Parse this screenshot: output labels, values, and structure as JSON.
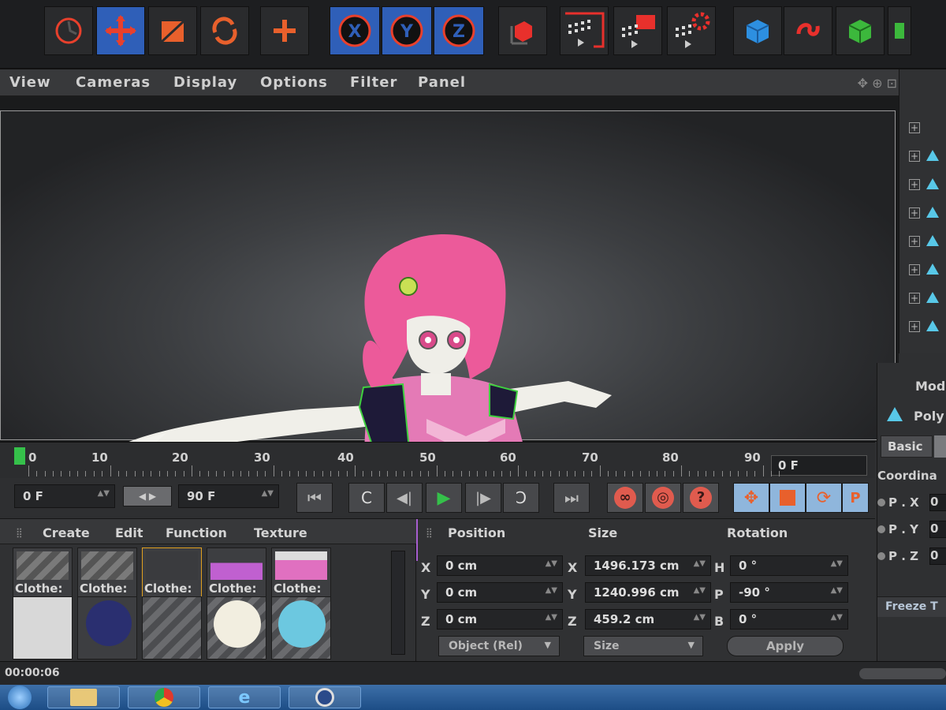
{
  "menubar": {
    "items": [
      "View",
      "Cameras",
      "Display",
      "Options",
      "Filter",
      "Panel"
    ]
  },
  "timeline": {
    "ticks": [
      "0",
      "10",
      "20",
      "30",
      "40",
      "50",
      "60",
      "70",
      "80",
      "90"
    ],
    "current_frame": "0 F"
  },
  "transport": {
    "start_frame": "0 F",
    "end_frame": "90 F"
  },
  "material_manager": {
    "menu": [
      "Create",
      "Edit",
      "Function",
      "Texture"
    ],
    "materials": [
      "Clothe:",
      "Clothe:",
      "Clothe:",
      "Clothe:",
      "Clothe:"
    ]
  },
  "coordinates": {
    "headers": {
      "position": "Position",
      "size": "Size",
      "rotation": "Rotation"
    },
    "axes": {
      "x": "X",
      "y": "Y",
      "z": "Z"
    },
    "rot_axes": {
      "h": "H",
      "p": "P",
      "b": "B"
    },
    "position": {
      "x": "0 cm",
      "y": "0 cm",
      "z": "0 cm"
    },
    "size": {
      "x": "1496.173 cm",
      "y": "1240.996 cm",
      "z": "459.2 cm"
    },
    "rotation": {
      "h": "0 °",
      "p": "-90 °",
      "b": "0 °"
    },
    "mode_dropdown": "Object (Rel)",
    "size_dropdown": "Size",
    "apply_label": "Apply"
  },
  "attributes": {
    "mode_label": "Mod",
    "object_label": "Poly",
    "basic_tab": "Basic",
    "section": "Coordina",
    "rows": [
      "P . X",
      "P . Y",
      "P . Z"
    ],
    "row_values": [
      "0",
      "0",
      "0"
    ],
    "freeze": "Freeze T"
  },
  "status": {
    "time": "00:00:06"
  },
  "colors": {
    "accent_blue": "#2f5fb8",
    "tool_red": "#e8402c",
    "play_green": "#35c04a"
  },
  "icons": {
    "toolbar": [
      "live-selection-icon",
      "move-icon",
      "scale-icon",
      "rotate-icon",
      "add-icon",
      "x-axis-icon",
      "y-axis-icon",
      "z-axis-icon",
      "world-coordinate-icon",
      "render-view-icon",
      "render-picture-viewer-icon",
      "render-settings-icon",
      "cube-icon",
      "spline-pen-icon",
      "generator-icon"
    ]
  }
}
